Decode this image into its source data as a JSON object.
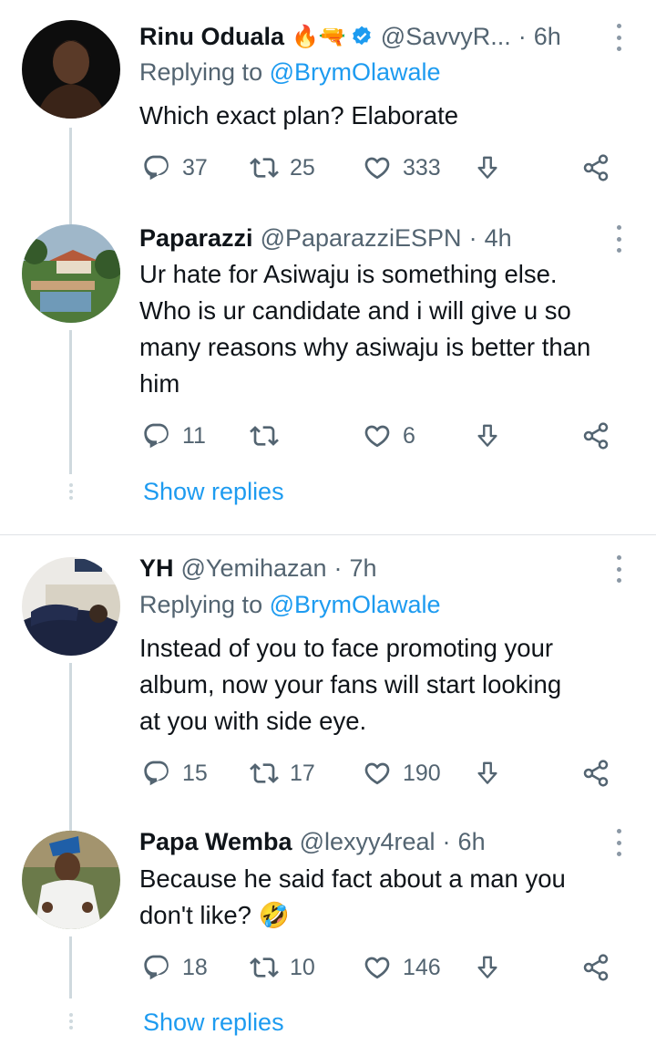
{
  "tweets": [
    {
      "name": "Rinu Oduala",
      "badges": "🔥🔫",
      "handle": "@SavvyR...",
      "time": "6h",
      "replying_prefix": "Replying to ",
      "replying_to": "@BrymOlawale",
      "text": "Which exact plan? Elaborate",
      "replies": "37",
      "retweets": "25",
      "likes": "333"
    },
    {
      "name": "Paparazzi",
      "handle": "@PaparazziESPN",
      "time": "4h",
      "text": "Ur hate for Asiwaju is something else.\nWho is ur candidate and i will give u so\nmany reasons why asiwaju is better than\nhim",
      "replies": "11",
      "retweets": "",
      "likes": "6"
    },
    {
      "name": "YH",
      "handle": "@Yemihazan",
      "time": "7h",
      "replying_prefix": "Replying to ",
      "replying_to": "@BrymOlawale",
      "text": "Instead of you to face promoting your\nalbum, now your fans will start looking\nat you with side eye.",
      "replies": "15",
      "retweets": "17",
      "likes": "190"
    },
    {
      "name": "Papa Wemba",
      "handle": "@lexyy4real",
      "time": "6h",
      "text": "Because he said fact about a man you\ndon't like? 🤣",
      "replies": "18",
      "retweets": "10",
      "likes": "146"
    }
  ],
  "show_replies_label": "Show replies",
  "separator": "·",
  "colors": {
    "accent": "#1d9bf0",
    "secondary_text": "#536471",
    "verified": "#1d9bf0",
    "thread_line": "#cfd9de"
  },
  "icons": [
    "reply-icon",
    "retweet-icon",
    "like-icon",
    "share-icon",
    "analytics-icon",
    "more-icon",
    "verified-icon"
  ]
}
